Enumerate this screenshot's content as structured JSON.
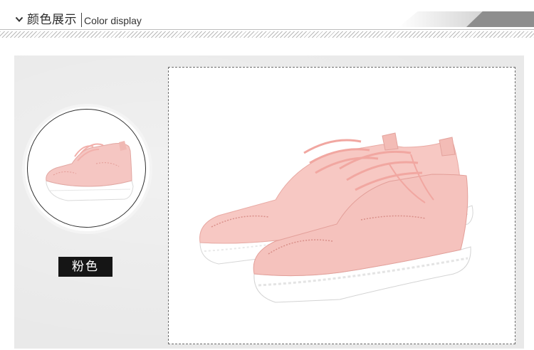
{
  "header": {
    "chevron_icon": "chevron-down-icon",
    "title_cn": "颜色展示",
    "title_en": "Color display",
    "accent_colors": [
      "#8e8e8e",
      "#c8c8c8"
    ]
  },
  "swatch": {
    "label": "粉色",
    "shoe_color": "#f5c6c2",
    "sole_color": "#ffffff"
  }
}
